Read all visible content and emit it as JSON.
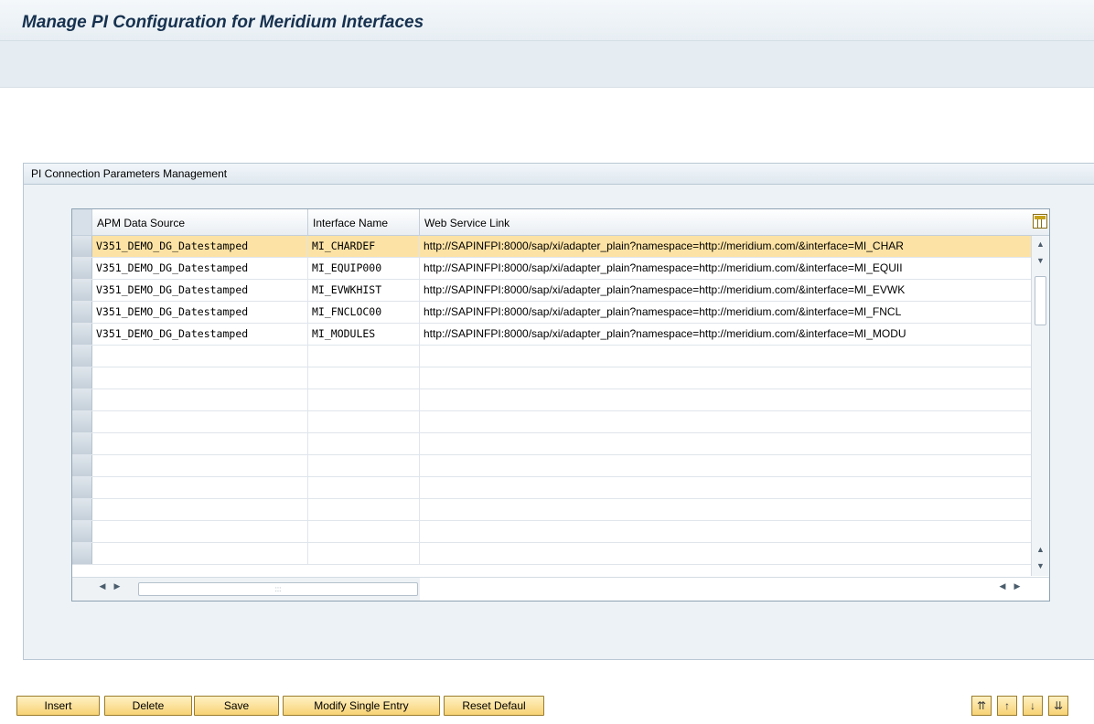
{
  "page": {
    "title": "Manage PI Configuration for Meridium Interfaces"
  },
  "panel": {
    "title": "PI Connection Parameters Management"
  },
  "table": {
    "columns": [
      "APM Data Source",
      "Interface Name",
      "Web Service Link"
    ],
    "rows": [
      [
        "V351_DEMO_DG_Datestamped",
        "MI_CHARDEF",
        "http://SAPINFPI:8000/sap/xi/adapter_plain?namespace=http://meridium.com/&interface=MI_CHAR"
      ],
      [
        "V351_DEMO_DG_Datestamped",
        "MI_EQUIP000",
        "http://SAPINFPI:8000/sap/xi/adapter_plain?namespace=http://meridium.com/&interface=MI_EQUII"
      ],
      [
        "V351_DEMO_DG_Datestamped",
        "MI_EVWKHIST",
        "http://SAPINFPI:8000/sap/xi/adapter_plain?namespace=http://meridium.com/&interface=MI_EVWK"
      ],
      [
        "V351_DEMO_DG_Datestamped",
        "MI_FNCLOC00",
        "http://SAPINFPI:8000/sap/xi/adapter_plain?namespace=http://meridium.com/&interface=MI_FNCL"
      ],
      [
        "V351_DEMO_DG_Datestamped",
        "MI_MODULES",
        "http://SAPINFPI:8000/sap/xi/adapter_plain?namespace=http://meridium.com/&interface=MI_MODU"
      ]
    ],
    "selected_row": 0,
    "empty_rows": 10
  },
  "buttons": {
    "insert": "Insert",
    "delete": "Delete",
    "save": "Save",
    "modify": "Modify Single Entry",
    "reset": "Reset Defaul"
  },
  "icon_buttons": [
    "first-page-icon",
    "previous-page-icon",
    "next-page-icon",
    "last-page-icon"
  ],
  "colors": {
    "selected_row": "#fce2a4",
    "button": "#f7d274",
    "title": "#16314f"
  }
}
